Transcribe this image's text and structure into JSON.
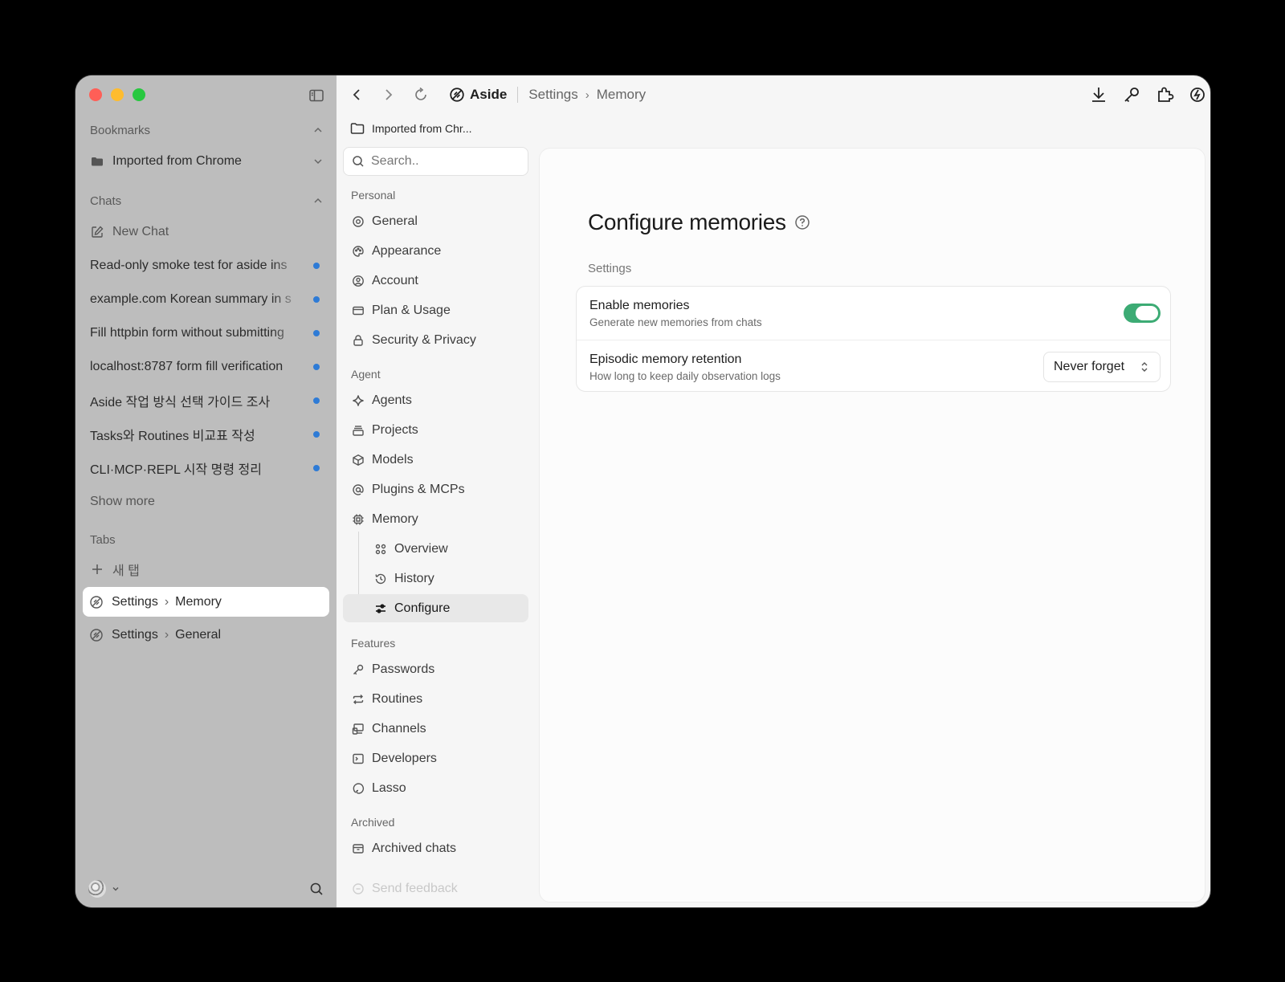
{
  "sidebar": {
    "bookmarks_label": "Bookmarks",
    "bookmark_folder": "Imported from Chrome",
    "chats_label": "Chats",
    "new_chat": "New Chat",
    "chats": [
      "Read-only smoke test for aside ins",
      "example.com Korean summary in s",
      "Fill httpbin form without submitting",
      "localhost:8787 form fill verification",
      "Aside 작업 방식 선택 가이드 조사",
      "Tasks와 Routines 비교표 작성",
      "CLI·MCP·REPL 시작 명령 정리"
    ],
    "show_more": "Show more",
    "tabs_label": "Tabs",
    "new_tab": "새 탭",
    "tabs": [
      {
        "section": "Settings",
        "page": "Memory"
      },
      {
        "section": "Settings",
        "page": "General"
      }
    ]
  },
  "topbar": {
    "app_name": "Aside",
    "crumb_1": "Settings",
    "crumb_2": "Memory",
    "chevron": "›"
  },
  "bookmark_bar": {
    "folder": "Imported from Chr..."
  },
  "settings_nav": {
    "search_placeholder": "Search..",
    "groups": {
      "personal": "Personal",
      "agent": "Agent",
      "features": "Features",
      "archived": "Archived"
    },
    "items": {
      "general": "General",
      "appearance": "Appearance",
      "account": "Account",
      "plan_usage": "Plan & Usage",
      "security_privacy": "Security & Privacy",
      "agents": "Agents",
      "projects": "Projects",
      "models": "Models",
      "plugins_mcps": "Plugins & MCPs",
      "memory": "Memory",
      "overview": "Overview",
      "history": "History",
      "configure": "Configure",
      "passwords": "Passwords",
      "routines": "Routines",
      "channels": "Channels",
      "developers": "Developers",
      "lasso": "Lasso",
      "archived_chats": "Archived chats",
      "send_feedback": "Send feedback"
    }
  },
  "content": {
    "title": "Configure memories",
    "section": "Settings",
    "enable_title": "Enable memories",
    "enable_desc": "Generate new memories from chats",
    "enable_on": true,
    "retention_title": "Episodic memory retention",
    "retention_desc": "How long to keep daily observation logs",
    "retention_value": "Never forget"
  },
  "colors": {
    "accent_toggle": "#3cab74",
    "unread_dot": "#2e7bd6"
  }
}
